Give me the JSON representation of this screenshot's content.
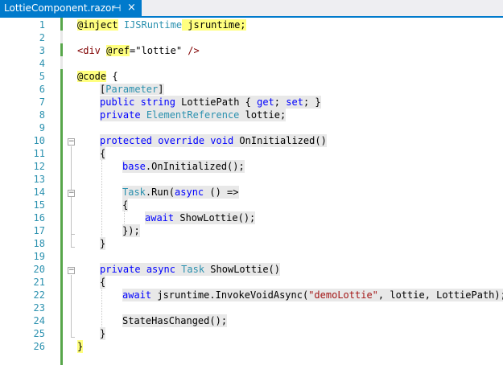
{
  "tab": {
    "title": "LottieComponent.razor",
    "pin_glyph": "⊣",
    "close_glyph": "×"
  },
  "colors": {
    "accent": "#007acc",
    "keyword": "#0000ff",
    "type": "#2b91af",
    "string": "#a31515",
    "line_number": "#2b91af",
    "razor_highlight": "#ffff7f"
  },
  "icons": {
    "pin": "pin-icon",
    "close": "close-icon",
    "fold": "collapse-icon"
  },
  "line_numbers": [
    "1",
    "2",
    "3",
    "4",
    "5",
    "6",
    "7",
    "8",
    "9",
    "10",
    "11",
    "12",
    "13",
    "14",
    "15",
    "16",
    "17",
    "18",
    "19",
    "20",
    "21",
    "22",
    "23",
    "24",
    "25",
    "26"
  ],
  "fold_glyph": "−",
  "code": {
    "l1": {
      "inject": "@inject",
      "sp": " ",
      "type": "IJSRuntime",
      "rest": " jsruntime;"
    },
    "l3": {
      "tag_open": "<div ",
      "ref": "@ref",
      "eq": "=",
      "val": "\"lottie\"",
      "tag_close": " />"
    },
    "l5": {
      "code": "@code",
      "sp": " ",
      "brace": "{"
    },
    "l6": {
      "open": "[",
      "attr": "Parameter",
      "close": "]"
    },
    "l7": {
      "kw1": "public",
      "sp1": " ",
      "kw2": "string",
      "name": " LottiePath { ",
      "get": "get",
      "semi1": "; ",
      "set": "set",
      "end": "; }"
    },
    "l8": {
      "kw": "private",
      "sp": " ",
      "type": "ElementReference",
      "rest": " lottie;"
    },
    "l10": {
      "kw1": "protected",
      "kw2": "override",
      "kw3": "void",
      "rest": " OnInitialized()"
    },
    "l11": {
      "text": "{"
    },
    "l12": {
      "kw": "base",
      "rest": ".OnInitialized();"
    },
    "l14": {
      "type": "Task",
      "mid": ".Run(",
      "kw": "async",
      "rest": " () =>"
    },
    "l15": {
      "text": "{"
    },
    "l16": {
      "kw": "await",
      "rest": " ShowLottie();"
    },
    "l17": {
      "text": "});"
    },
    "l18": {
      "text": "}"
    },
    "l20": {
      "kw1": "private",
      "kw2": "async",
      "type": "Task",
      "rest": " ShowLottie()"
    },
    "l21": {
      "text": "{"
    },
    "l22": {
      "kw": "await",
      "mid": " jsruntime.InvokeVoidAsync(",
      "str": "\"demoLottie\"",
      "rest": ", lottie, LottiePath);"
    },
    "l24": {
      "text": "StateHasChanged();"
    },
    "l25": {
      "text": "}"
    },
    "l26": {
      "text": "}"
    }
  }
}
